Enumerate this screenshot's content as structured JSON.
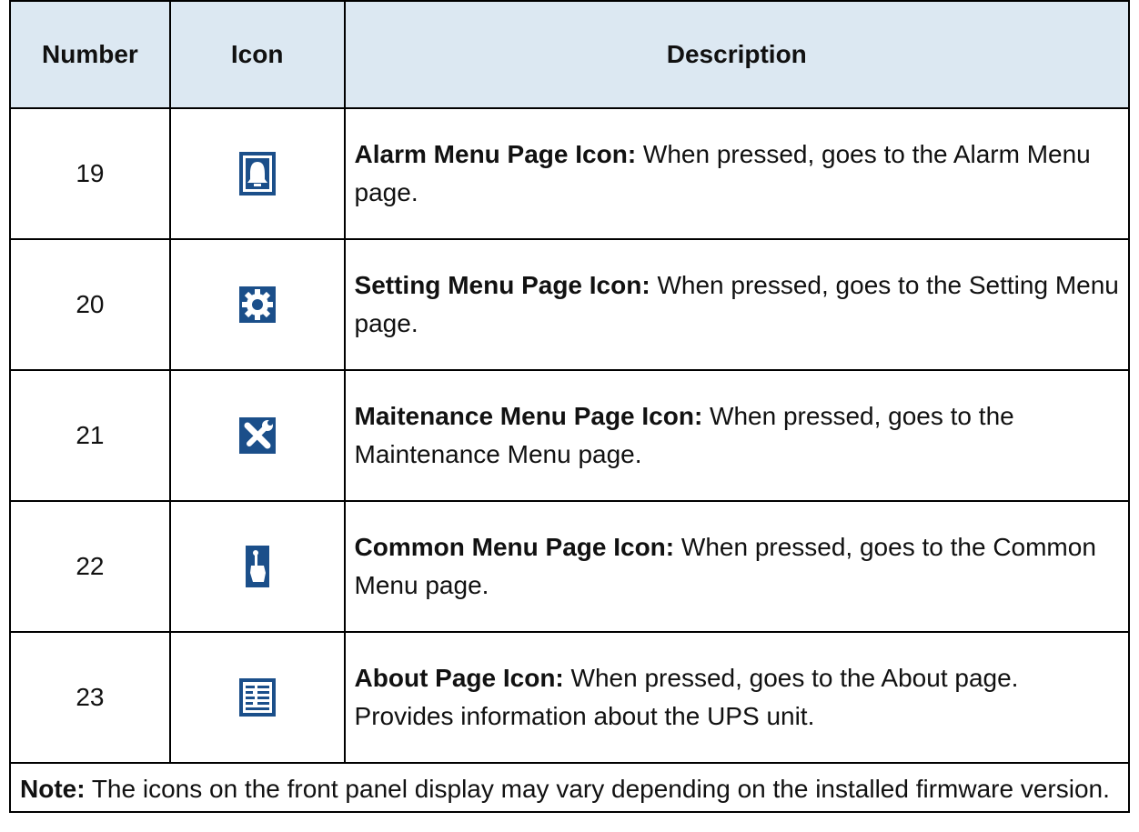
{
  "table": {
    "headers": [
      "Number",
      "Icon",
      "Description"
    ],
    "rows": [
      {
        "number": "19",
        "icon": "alarm-bell-icon",
        "title": "Alarm Menu Page Icon:",
        "text": " When pressed, goes to the Alarm Menu page."
      },
      {
        "number": "20",
        "icon": "gear-settings-icon",
        "title": "Setting Menu Page Icon:",
        "text": " When pressed, goes to the Setting Menu page."
      },
      {
        "number": "21",
        "icon": "wrench-screwdriver-icon",
        "title": "Maitenance Menu Page Icon:",
        "text": " When pressed, goes to the Maintenance Menu page."
      },
      {
        "number": "22",
        "icon": "hand-pointer-icon",
        "title": "Common Menu Page Icon:",
        "text": " When pressed, goes to the Common Menu page."
      },
      {
        "number": "23",
        "icon": "about-document-icon",
        "title": "About Page Icon:",
        "text": " When pressed, goes to the About page. Provides information about the UPS unit."
      }
    ],
    "note_title": "Note:",
    "note_text": " The icons on the front panel display may vary depending on the installed firmware version."
  },
  "colors": {
    "header_bg": "#dce8f2",
    "icon_blue": "#1b4f8a"
  }
}
